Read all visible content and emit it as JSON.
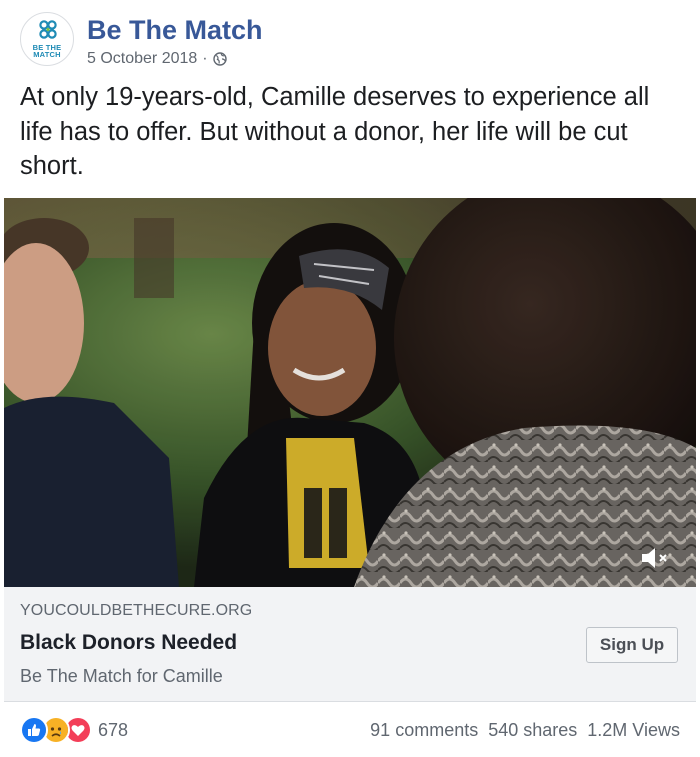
{
  "post": {
    "page_name": "Be The Match",
    "logo_text": [
      "BE THE",
      "MATCH"
    ],
    "date": "5 October 2018",
    "separator": "·",
    "privacy_icon": "globe-icon",
    "message": "At only 19-years-old, Camille deserves to experience all life has to offer. But without a donor, her life will be cut short."
  },
  "media": {
    "type": "video",
    "mute_icon": "speaker-muted-icon"
  },
  "link_preview": {
    "domain": "YOUCOULDBETHECURE.ORG",
    "title": "Black Donors Needed",
    "description": "Be The Match for Camille",
    "cta_label": "Sign Up"
  },
  "footer": {
    "reaction_icons": [
      "like-icon",
      "sad-icon",
      "love-icon"
    ],
    "reaction_count": "678",
    "comments": "91 comments",
    "shares": "540 shares",
    "views": "1.2M Views"
  },
  "colors": {
    "page_name": "#385898",
    "logo": "#1f8bb5",
    "like": "#1877f2",
    "love": "#f33e58",
    "sad": "#f7b125"
  }
}
